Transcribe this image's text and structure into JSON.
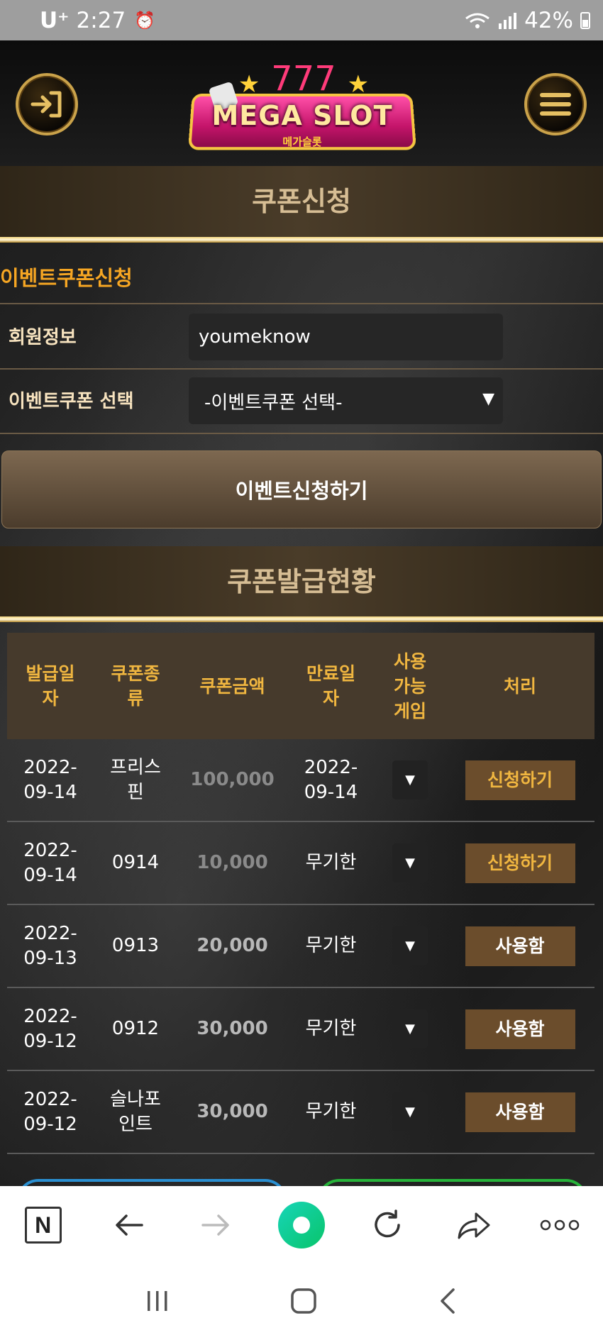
{
  "status_bar": {
    "carrier": "U⁺",
    "time": "2:27",
    "battery": "42%"
  },
  "header": {
    "logo_text": "MEGA SLOT",
    "logo_subtext": "메가슬롯"
  },
  "coupon_apply": {
    "title": "쿠폰신청",
    "event_title": "이벤트쿠폰신청",
    "member_label": "회원정보",
    "member_value": "youmeknow",
    "select_label": "이벤트쿠폰 선택",
    "select_value": "-이벤트쿠폰 선택-",
    "apply_button": "이벤트신청하기"
  },
  "coupon_status": {
    "title": "쿠폰발급현황",
    "headers": [
      "발급일자",
      "쿠폰종류",
      "쿠폰금액",
      "만료일자",
      "사용가능게임",
      "처리"
    ],
    "rows": [
      {
        "date": "2022-09-14",
        "type": "프리스핀",
        "amount": "100,000",
        "expire": "2022-09-14",
        "action": "신청하기"
      },
      {
        "date": "2022-09-14",
        "type": "0914",
        "amount": "10,000",
        "expire": "무기한",
        "action": "신청하기"
      },
      {
        "date": "2022-09-13",
        "type": "0913",
        "amount": "20,000",
        "expire": "무기한",
        "action": "사용함"
      },
      {
        "date": "2022-09-12",
        "type": "0912",
        "amount": "30,000",
        "expire": "무기한",
        "action": "사용함"
      },
      {
        "date": "2022-09-12",
        "type": "슬나포인트",
        "amount": "30,000",
        "expire": "무기한",
        "action": "사용함"
      }
    ]
  }
}
